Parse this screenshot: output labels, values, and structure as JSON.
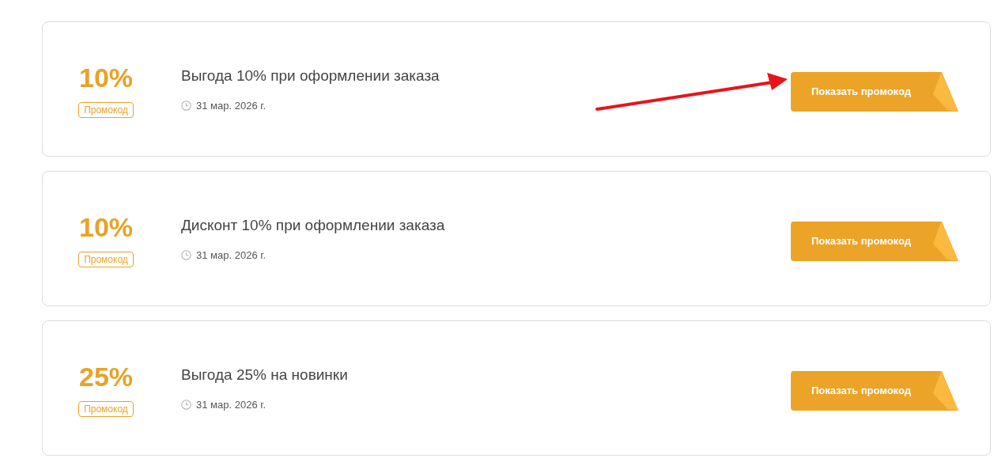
{
  "offers": [
    {
      "discount": "10%",
      "badge": "Промокод",
      "title": "Выгода 10% при оформлении заказа",
      "date": "31 мар. 2026 г.",
      "button": "Показать промокод"
    },
    {
      "discount": "10%",
      "badge": "Промокод",
      "title": "Дисконт 10% при оформлении заказа",
      "date": "31 мар. 2026 г.",
      "button": "Показать промокод"
    },
    {
      "discount": "25%",
      "badge": "Промокод",
      "title": "Выгода 25% на новинки",
      "date": "31 мар. 2026 г.",
      "button": "Показать промокод"
    }
  ]
}
